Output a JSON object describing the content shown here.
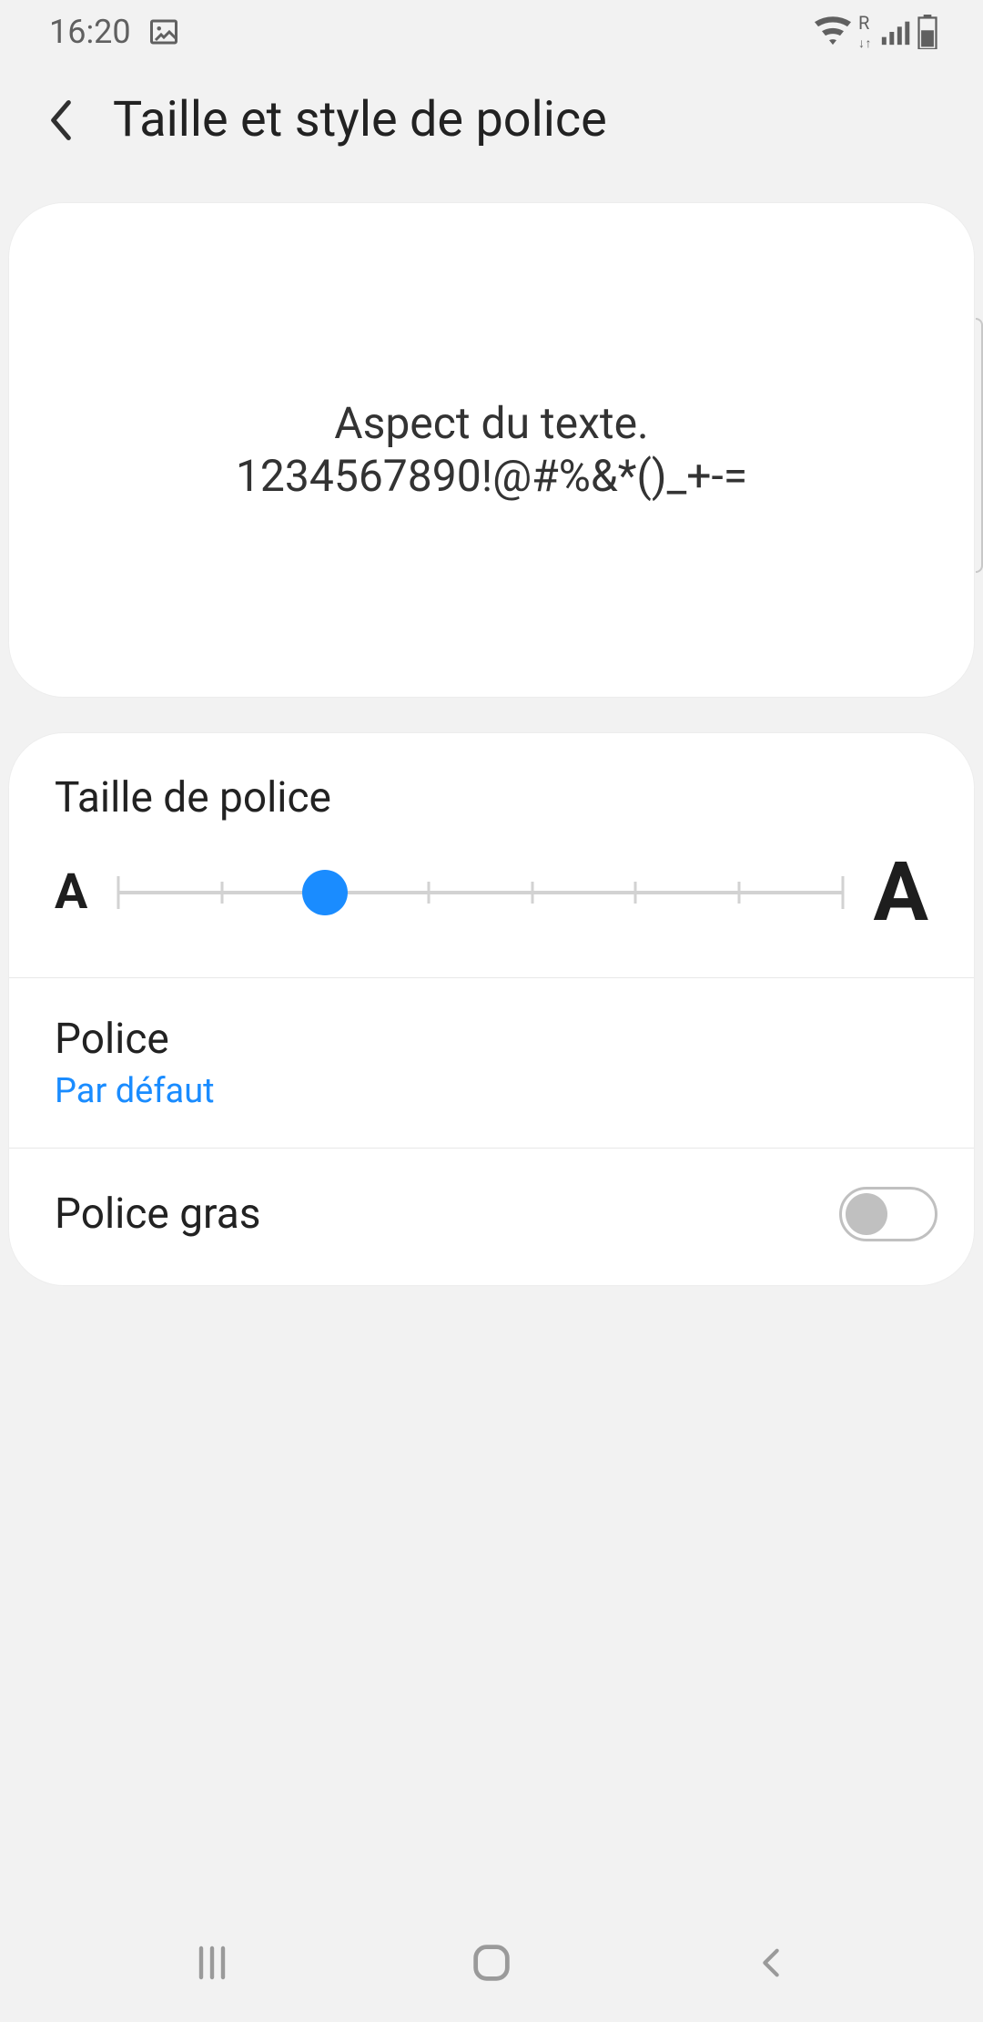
{
  "status": {
    "time": "16:20"
  },
  "header": {
    "title": "Taille et style de police"
  },
  "preview": {
    "line1": "Aspect du texte.",
    "line2": "1234567890!@#%&*()_+-="
  },
  "fontSize": {
    "label": "Taille de police",
    "slider": {
      "steps": 8,
      "value_index": 2,
      "accent": "#1a8cff"
    }
  },
  "fontStyle": {
    "label": "Police",
    "value": "Par défaut",
    "value_color": "#1a8cff"
  },
  "boldFont": {
    "label": "Police gras",
    "enabled": false
  }
}
